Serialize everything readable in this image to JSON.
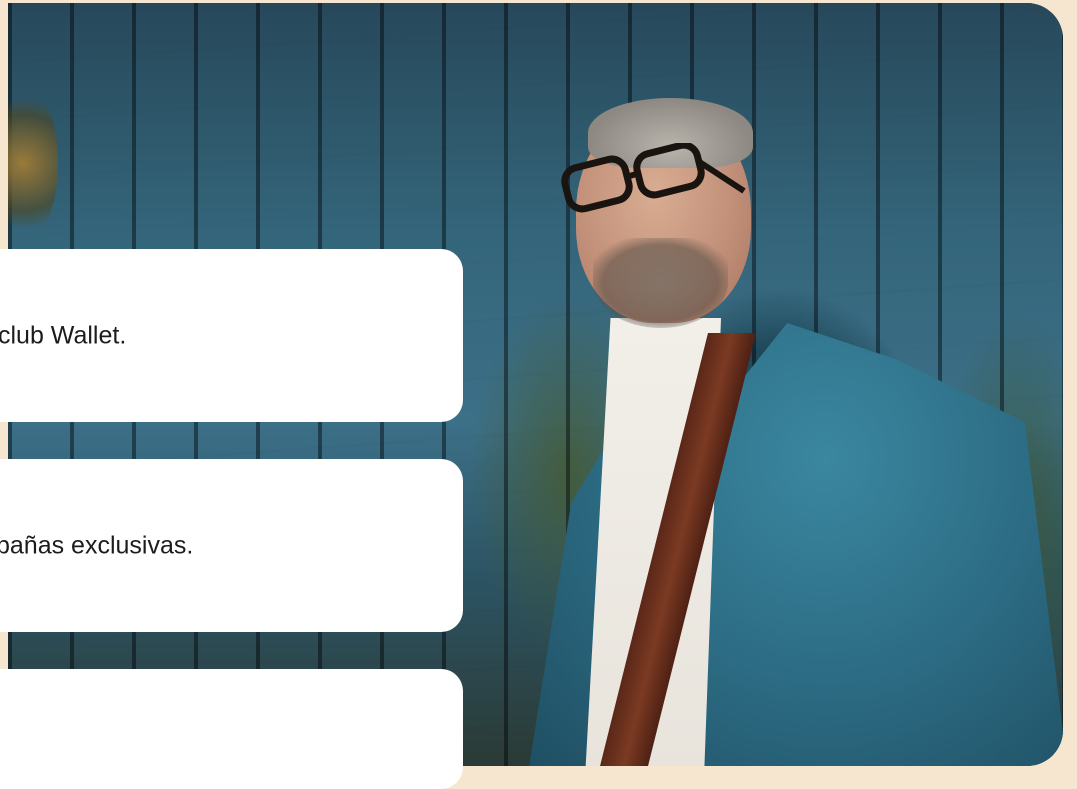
{
  "hero": {
    "image_alt": "",
    "colors": {
      "page_background": "#f7e6cf",
      "card_background": "#ffffff",
      "text": "#1c1c1c",
      "jacket": "#2c6c84",
      "strap": "#7b3a22"
    }
  },
  "feature_cards": [
    {
      "text": "club Wallet."
    },
    {
      "text": "pañas exclusivas."
    },
    {
      "text": ""
    }
  ]
}
